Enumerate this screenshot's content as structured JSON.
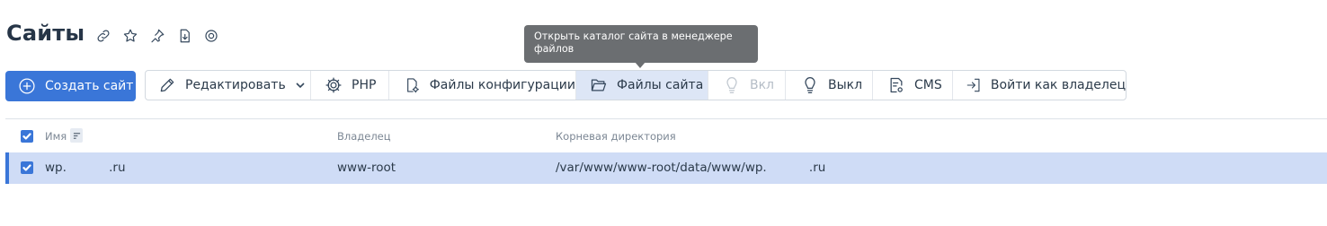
{
  "page": {
    "title": "Сайты"
  },
  "title_icons": [
    "link-icon",
    "star-icon",
    "pin-icon",
    "download-file-icon",
    "help-icon"
  ],
  "tooltip": {
    "text": "Открыть каталог сайта в менеджере файлов"
  },
  "toolbar": {
    "create_label": "Создать сайт",
    "edit_label": "Редактировать",
    "php_label": "PHP",
    "config_label": "Файлы конфигурации",
    "site_files_label": "Файлы сайта",
    "on_label": "Вкл",
    "off_label": "Выкл",
    "cms_label": "CMS",
    "login_owner_label": "Войти как владелец"
  },
  "table": {
    "columns": {
      "name": "Имя",
      "owner": "Владелец",
      "root": "Корневая директория"
    },
    "rows": [
      {
        "name": "wp.           .ru",
        "owner": "www-root",
        "root": "/var/www/www-root/data/www/wp.           .ru",
        "selected": true
      }
    ]
  },
  "colors": {
    "accent": "#3a76d8",
    "selected_row": "#cfdcf6",
    "active_button": "#dde6f6"
  }
}
